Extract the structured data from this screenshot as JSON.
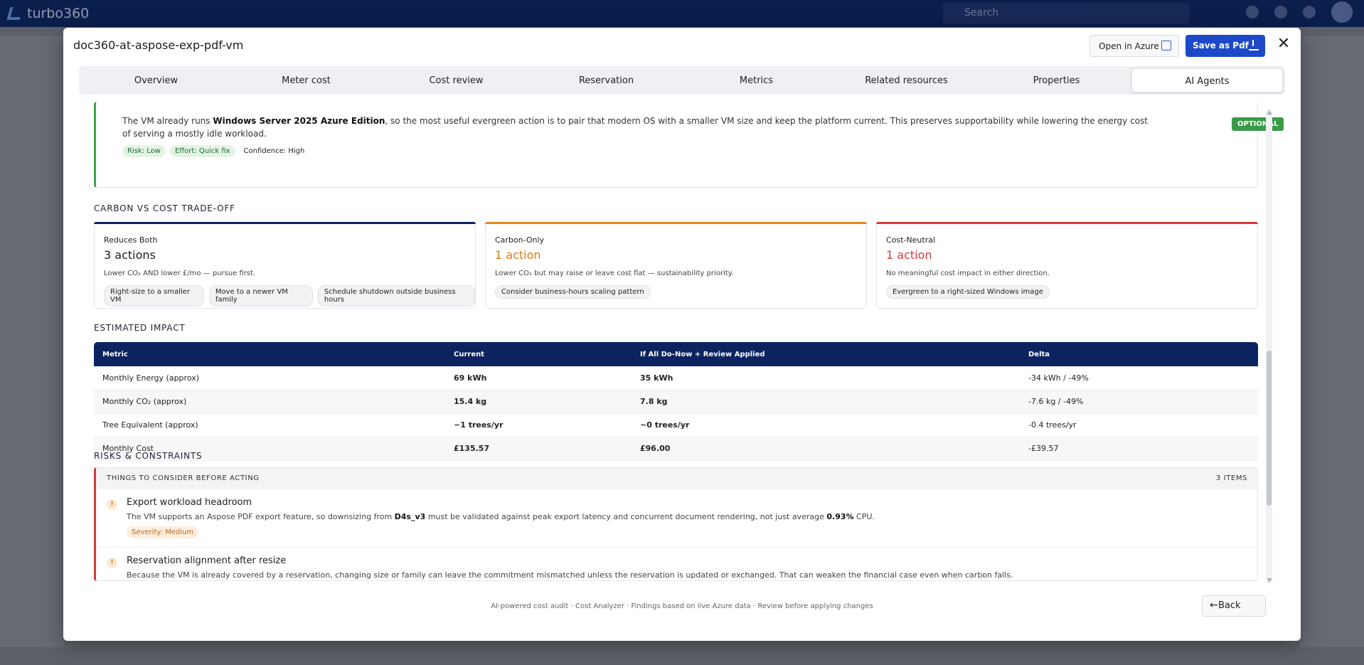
{
  "app": {
    "name": "turbo360",
    "search_placeholder": "Search"
  },
  "modal": {
    "title": "doc360-at-aspose-exp-pdf-vm",
    "open_azure_label": "Open in Azure",
    "save_pdf_label": "Save as Pdf",
    "close_label": "✕"
  },
  "tabs": [
    "Overview",
    "Meter cost",
    "Cost review",
    "Reservation",
    "Metrics",
    "Related resources",
    "Properties",
    "AI Agents"
  ],
  "recommendation": {
    "text_pre": "The VM already runs ",
    "text_bold": "Windows Server 2025 Azure Edition",
    "text_post": ", so the most useful evergreen action is to pair that modern OS with a smaller VM size and keep the platform current. This preserves supportability while lowering the energy cost of serving a mostly idle workload.",
    "risk": "Risk: Low",
    "effort": "Effort: Quick fix",
    "confidence": "Confidence: High",
    "badge": "OPTIONAL"
  },
  "tradeoff": {
    "heading": "CARBON VS COST TRADE-OFF",
    "cards": [
      {
        "name": "Reduces Both",
        "count": "3 actions",
        "desc": "Lower CO₂ AND lower £/mo — pursue first.",
        "chips": [
          "Right-size to a smaller VM",
          "Move to a newer VM family",
          "Schedule shutdown outside business hours"
        ],
        "color": "#0b2460",
        "count_color": "#1e1e1e"
      },
      {
        "name": "Carbon-Only",
        "count": "1 action",
        "desc": "Lower CO₂ but may raise or leave cost flat — sustainability priority.",
        "chips": [
          "Consider business-hours scaling pattern"
        ],
        "color": "#e08a1e",
        "count_color": "#e07a10"
      },
      {
        "name": "Cost-Neutral",
        "count": "1 action",
        "desc": "No meaningful cost impact in either direction.",
        "chips": [
          "Evergreen to a right-sized Windows image"
        ],
        "color": "#d93838",
        "count_color": "#d93838"
      }
    ]
  },
  "impact": {
    "heading": "ESTIMATED IMPACT",
    "columns": [
      "Metric",
      "Current",
      "If All Do-Now + Review Applied",
      "Delta"
    ],
    "rows": [
      [
        "Monthly Energy (approx)",
        "69 kWh",
        "35 kWh",
        "-34 kWh / -49%"
      ],
      [
        "Monthly CO₂ (approx)",
        "15.4 kg",
        "7.8 kg",
        "-7.6 kg / -49%"
      ],
      [
        "Tree Equivalent (approx)",
        "~1 trees/yr",
        "~0 trees/yr",
        "-0.4 trees/yr"
      ],
      [
        "Monthly Cost",
        "£135.57",
        "£96.00",
        "-£39.57"
      ]
    ]
  },
  "risks": {
    "heading": "RISKS & CONSTRAINTS",
    "box_title": "THINGS TO CONSIDER BEFORE ACTING",
    "count": "3 ITEMS",
    "items": [
      {
        "title": "Export workload headroom",
        "desc_pre": "The VM supports an Aspose PDF export feature, so downsizing from ",
        "desc_bold1": "D4s_v3",
        "desc_mid": " must be validated against peak export latency and concurrent document rendering, not just average ",
        "desc_bold2": "0.93%",
        "desc_post": " CPU.",
        "severity": "Severity: Medium"
      },
      {
        "title": "Reservation alignment after resize",
        "desc": "Because the VM is already covered by a reservation, changing size or family can leave the commitment mismatched unless the reservation is updated or exchanged. That can weaken the financial case even when carbon falls."
      }
    ]
  },
  "footer": {
    "text": "AI-powered cost audit · Cost Analyzer · Findings based on live Azure data · Review before applying changes",
    "back_label": "Back"
  }
}
